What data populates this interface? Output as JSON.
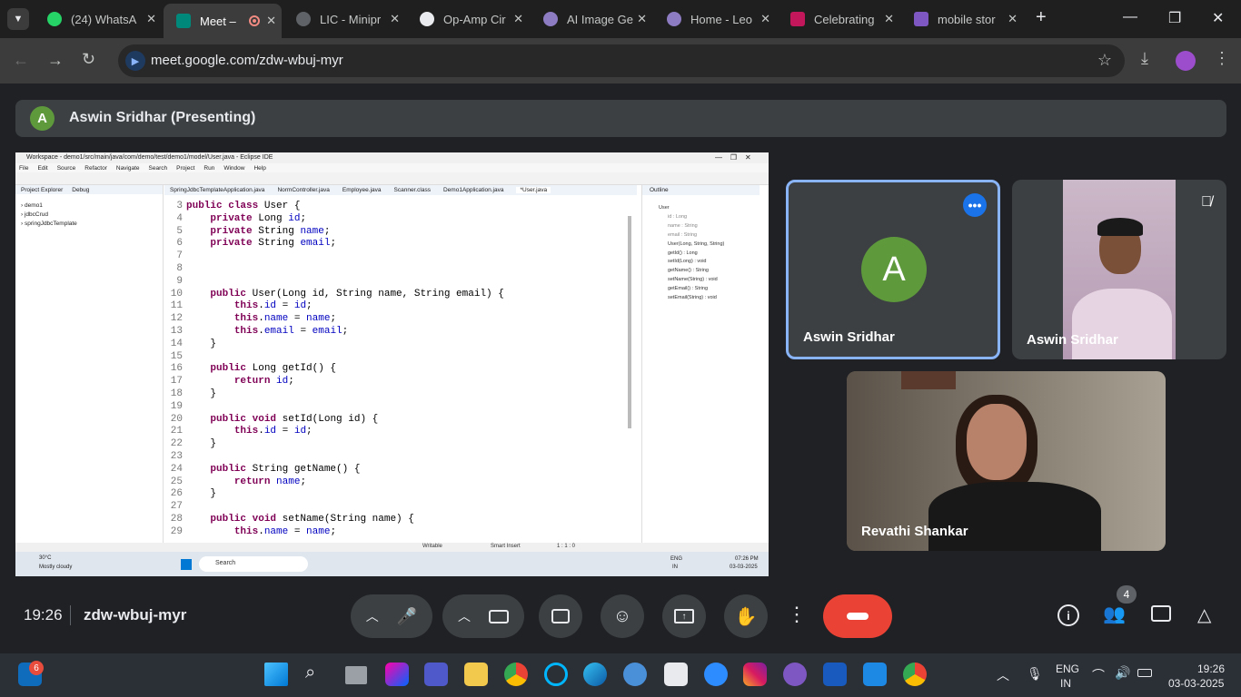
{
  "browser": {
    "tabs": [
      {
        "title": "(24) WhatsA",
        "color": "#25d366"
      },
      {
        "title": "Meet – ",
        "color": "#00897b"
      },
      {
        "title": "LIC - Minipr",
        "color": "#9aa0a6"
      },
      {
        "title": "Op-Amp Cir",
        "color": "#e8eaed"
      },
      {
        "title": "AI Image Ge",
        "color": "#8e7cc3"
      },
      {
        "title": "Home - Leo",
        "color": "#8e7cc3"
      },
      {
        "title": "Celebrating",
        "color": "#c2185b"
      },
      {
        "title": "mobile stor",
        "color": "#7e57c2"
      }
    ],
    "url": "meet.google.com/zdw-wbuj-myr",
    "badge": "24"
  },
  "meet": {
    "presenter_label": "Aswin Sridhar (Presenting)",
    "presenter_initial": "A",
    "participants": [
      {
        "name": "Aswin Sridhar",
        "initial": "A"
      },
      {
        "name": "Aswin Sridhar"
      },
      {
        "name": "Revathi Shankar"
      }
    ],
    "time": "19:26",
    "meeting_code": "zdw-wbuj-myr",
    "people_count": "4"
  },
  "eclipse": {
    "title": "Workspace - demo1/src/main/java/com/demo/test/demo1/model/User.java - Eclipse IDE",
    "menu": [
      "File",
      "Edit",
      "Source",
      "Refactor",
      "Navigate",
      "Search",
      "Project",
      "Run",
      "Window",
      "Help"
    ],
    "explorer_tabs": [
      "Project Explorer",
      "Debug"
    ],
    "projects": [
      "demo1",
      "jdbcCrud",
      "springJdbcTemplate"
    ],
    "editor_tabs": [
      "SpringJdbcTemplateApplication.java",
      "NormController.java",
      "Employee.java",
      "Scanner.class",
      "Demo1Application.java",
      "*User.java"
    ],
    "outline_title": "Outline",
    "outline": [
      "User",
      "id : Long",
      "name : String",
      "email : String",
      "User(Long, String, String)",
      "getId() : Long",
      "setId(Long) : void",
      "getName() : String",
      "setName(String) : void",
      "getEmail() : String",
      "setEmail(String) : void"
    ],
    "status": [
      "Writable",
      "Smart Insert",
      "1 : 1 : 0"
    ],
    "code": [
      {
        "n": "3",
        "t": "public class User {"
      },
      {
        "n": "4",
        "t": "    private Long id;"
      },
      {
        "n": "5",
        "t": "    private String name;"
      },
      {
        "n": "6",
        "t": "    private String email;"
      },
      {
        "n": "7",
        "t": ""
      },
      {
        "n": "8",
        "t": ""
      },
      {
        "n": "9",
        "t": ""
      },
      {
        "n": "10",
        "t": "    public User(Long id, String name, String email) {"
      },
      {
        "n": "11",
        "t": "        this.id = id;"
      },
      {
        "n": "12",
        "t": "        this.name = name;"
      },
      {
        "n": "13",
        "t": "        this.email = email;"
      },
      {
        "n": "14",
        "t": "    }"
      },
      {
        "n": "15",
        "t": ""
      },
      {
        "n": "16",
        "t": "    public Long getId() {"
      },
      {
        "n": "17",
        "t": "        return id;"
      },
      {
        "n": "18",
        "t": "    }"
      },
      {
        "n": "19",
        "t": ""
      },
      {
        "n": "20",
        "t": "    public void setId(Long id) {"
      },
      {
        "n": "21",
        "t": "        this.id = id;"
      },
      {
        "n": "22",
        "t": "    }"
      },
      {
        "n": "23",
        "t": ""
      },
      {
        "n": "24",
        "t": "    public String getName() {"
      },
      {
        "n": "25",
        "t": "        return name;"
      },
      {
        "n": "26",
        "t": "    }"
      },
      {
        "n": "27",
        "t": ""
      },
      {
        "n": "28",
        "t": "    public void setName(String name) {"
      },
      {
        "n": "29",
        "t": "        this.name = name;"
      }
    ],
    "weather_temp": "30°C",
    "weather_desc": "Mostly cloudy",
    "search": "Search",
    "lang": "ENG",
    "lang2": "IN",
    "clock": "07:26 PM",
    "date": "03-03-2025"
  },
  "taskbar": {
    "store_badge": "6",
    "lang": "ENG",
    "region": "IN",
    "time": "19:26",
    "date": "03-03-2025"
  }
}
